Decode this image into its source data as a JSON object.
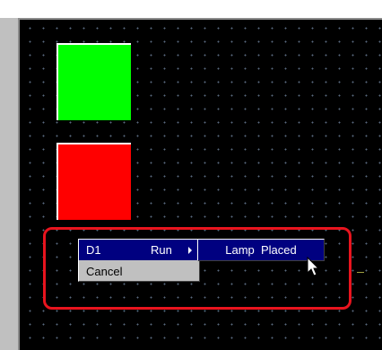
{
  "canvas": {
    "background": "#000000",
    "grid": "dotted"
  },
  "lamps": [
    {
      "name": "green",
      "color": "#00ff00"
    },
    {
      "name": "red",
      "color": "#ff0000"
    }
  ],
  "context_menu": {
    "items": [
      {
        "label": "D1",
        "action": "Run",
        "has_submenu": true,
        "selected": true
      },
      {
        "label": "Cancel",
        "selected": false
      }
    ],
    "submenu": {
      "items": [
        {
          "label": "Lamp  Placed",
          "selected": true
        }
      ]
    }
  },
  "highlight_color": "#e8141e",
  "selection_color": "#000080"
}
